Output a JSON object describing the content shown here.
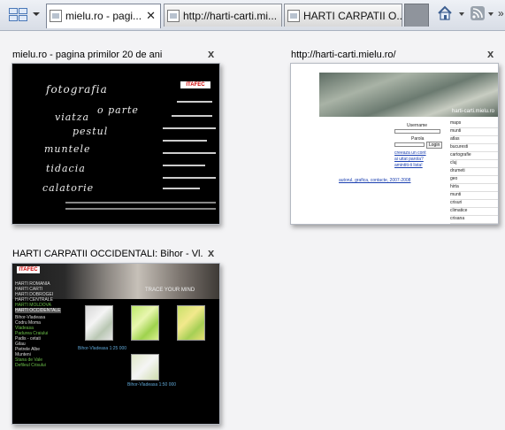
{
  "tabs": [
    {
      "label": "mielu.ro - pagi...",
      "close": "✕",
      "active": true
    },
    {
      "label": "http://harti-carti.mi...",
      "active": false
    },
    {
      "label": "HARTI CARPATII O...",
      "active": false
    }
  ],
  "toolbar": {
    "quick_tabs_icon": "grid-icon",
    "home_icon": "home-icon",
    "feeds_icon": "rss-icon",
    "more": "»"
  },
  "quick_tabs": [
    {
      "title": "mielu.ro - pagina primilor 20 de ani",
      "close": "x"
    },
    {
      "title": "http://harti-carti.mielu.ro/",
      "close": "x"
    },
    {
      "title": "HARTI CARPATII OCCIDENTALI: Bihor - Vl...",
      "close": "x"
    }
  ],
  "thumb_mielu": {
    "menu": [
      "fotografia",
      "o parte",
      "viatza",
      "pestul",
      "muntele",
      "tidacia",
      "calatorie"
    ],
    "logo": "ITAFEC"
  },
  "thumb_harti": {
    "banner_text": "harti-carti.mielu.ro",
    "username_label": "Username",
    "password_label": "Parola",
    "login_button": "Login",
    "links": [
      "creeaza un cont",
      "ai uitat parola?",
      "amintiti-ti lista!"
    ],
    "footer_links": "autorul, grafica, contacte, 2007-2008",
    "side_items": [
      "maps",
      "munti",
      "atlas",
      "bucuresti",
      "cartografie",
      "cluj",
      "drumeti",
      "geo",
      "hirta",
      "munti",
      "crisuri",
      "climatice",
      "crisana"
    ]
  },
  "thumb_carpatii": {
    "logo": "ITAFEC",
    "tagline": "TRACE YOUR MIND",
    "nav": [
      "HARTI ROMANIA",
      "HARTI CARTI",
      "HARTI DOBROGEI",
      "HARTI CENTRALE",
      "HARTI MOLDOVA",
      "HARTI OCCIDENTALE",
      "Bihor-Vladeasa",
      "Codru Moma",
      "Vladeasa",
      "Padurea Craiului",
      "Padis - cetati",
      "Gilau",
      "Pietrele Albe",
      "Munteni",
      "Stana de Vale",
      "Defileul Crisului"
    ],
    "caption_1": "Bihor-Vladeasa 1:25 000",
    "caption_2": "Bihor-Vladeasa 1:50 000"
  }
}
